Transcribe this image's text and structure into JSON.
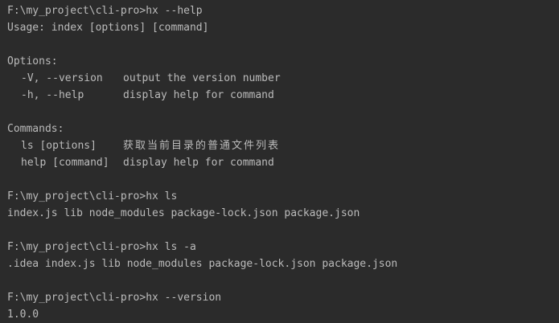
{
  "terminal": {
    "blocks": [
      {
        "prompt": "F:\\my_project\\cli-pro>",
        "command": "hx --help"
      }
    ],
    "help": {
      "usage": "Usage: index [options] [command]",
      "options_heading": "Options:",
      "options": [
        {
          "name": "-V, --version",
          "desc": "output the version number"
        },
        {
          "name": "-h, --help",
          "desc": "display help for command"
        }
      ],
      "commands_heading": "Commands:",
      "commands": [
        {
          "name": "ls [options]",
          "desc": "获取当前目录的普通文件列表"
        },
        {
          "name": "help [command]",
          "desc": "display help for command"
        }
      ]
    },
    "run2": {
      "prompt": "F:\\my_project\\cli-pro>",
      "command": "hx ls",
      "output": "index.js lib node_modules package-lock.json package.json"
    },
    "run3": {
      "prompt": "F:\\my_project\\cli-pro>",
      "command": "hx ls -a",
      "output": ".idea index.js lib node_modules package-lock.json package.json"
    },
    "run4": {
      "prompt": "F:\\my_project\\cli-pro>",
      "command": "hx --version",
      "output": "1.0.0"
    }
  },
  "colors": {
    "background": "#2b2b2b",
    "text": "#bbbbbb"
  }
}
